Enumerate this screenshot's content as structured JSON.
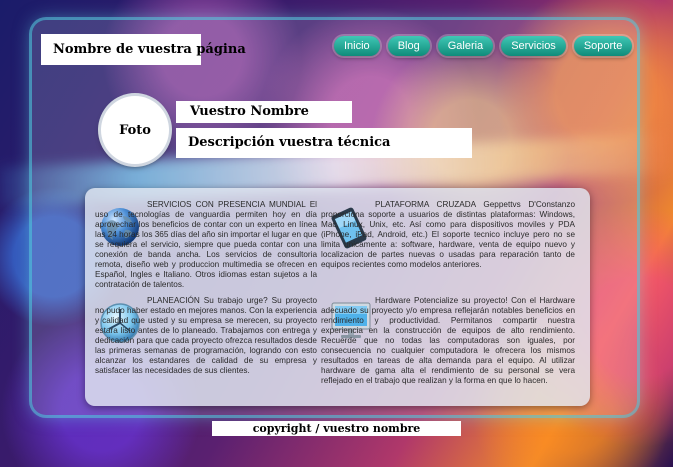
{
  "header": {
    "site_title": "Nombre de vuestra página"
  },
  "nav": {
    "items": [
      "Inicio",
      "Blog",
      "Galeria",
      "Servicios",
      "Soporte"
    ]
  },
  "profile": {
    "photo_label": "Foto",
    "name": "Vuestro Nombre",
    "description": "Descripción vuestra técnica"
  },
  "services": [
    {
      "icon": "globe-icon",
      "text": "SERVICIOS CON PRESENCIA MUNDIAL El uso de tecnologías de vanguardia permiten hoy en día aprovechar los beneficios de contar con un experto en línea las 24 horas los 365 días del año sin importar el lugar en que se requiera el servicio, siempre que pueda contar con una conexión de banda ancha. Los servicios de consultoria remota, diseño web y produccion multimedia se ofrecen en Español, Ingles e Italiano. Otros idiomas estan sujetos a la contratación de talentos."
    },
    {
      "icon": "tablet-icon",
      "text": "PLATAFORMA CRUZADA Geppettvs D'Constanzo proporciona soporte a usuarios de distintas plataformas: Windows, Mac, Linux, Unix, etc. Así como para dispositivos moviles y PDA (iPhone, iPad, Android, etc.) El soporte tecnico incluye pero no se limita unicamente a: software, hardware, venta de equipo nuevo y localizacion de partes nuevas o usadas para reparación tanto de equipos recientes como modelos anteriores."
    },
    {
      "icon": "clock-icon",
      "text": "PLANEACIÓN Su trabajo urge? Su proyecto no pudo haber estado en mejores manos. Con la experiencia y calidad que usted y su empresa se merecen, su proyecto estara listo antes de lo planeado. Trabajamos con entrega y dedicación para que cada proyecto ofrezca resultados desde las primeras semanas de programación, logrando con esto alcanzar los estandares de calidad de su empresa y satisfacer las necesidades de sus clientes."
    },
    {
      "icon": "monitor-icon",
      "text": "Hardware Potencialize su proyecto! Con el Hardware adecuado su proyecto y/o empresa reflejarán notables beneficios en rendimiento y productividad. Permitanos compartir nuestra experiencia en la construcción de equipos de alto rendimiento. Recuerde que no todas las computadoras son iguales, por consecuencia no cualquier computadora le ofrecera los mismos resultados en tareas de alta demanda para el equipo. Al utilizar hardware de gama alta el rendimiento de su personal se vera reflejado en el trabajo que realizan y la forma en que lo hacen."
    }
  ],
  "footer": {
    "copyright": "copyright / vuestro nombre"
  }
}
